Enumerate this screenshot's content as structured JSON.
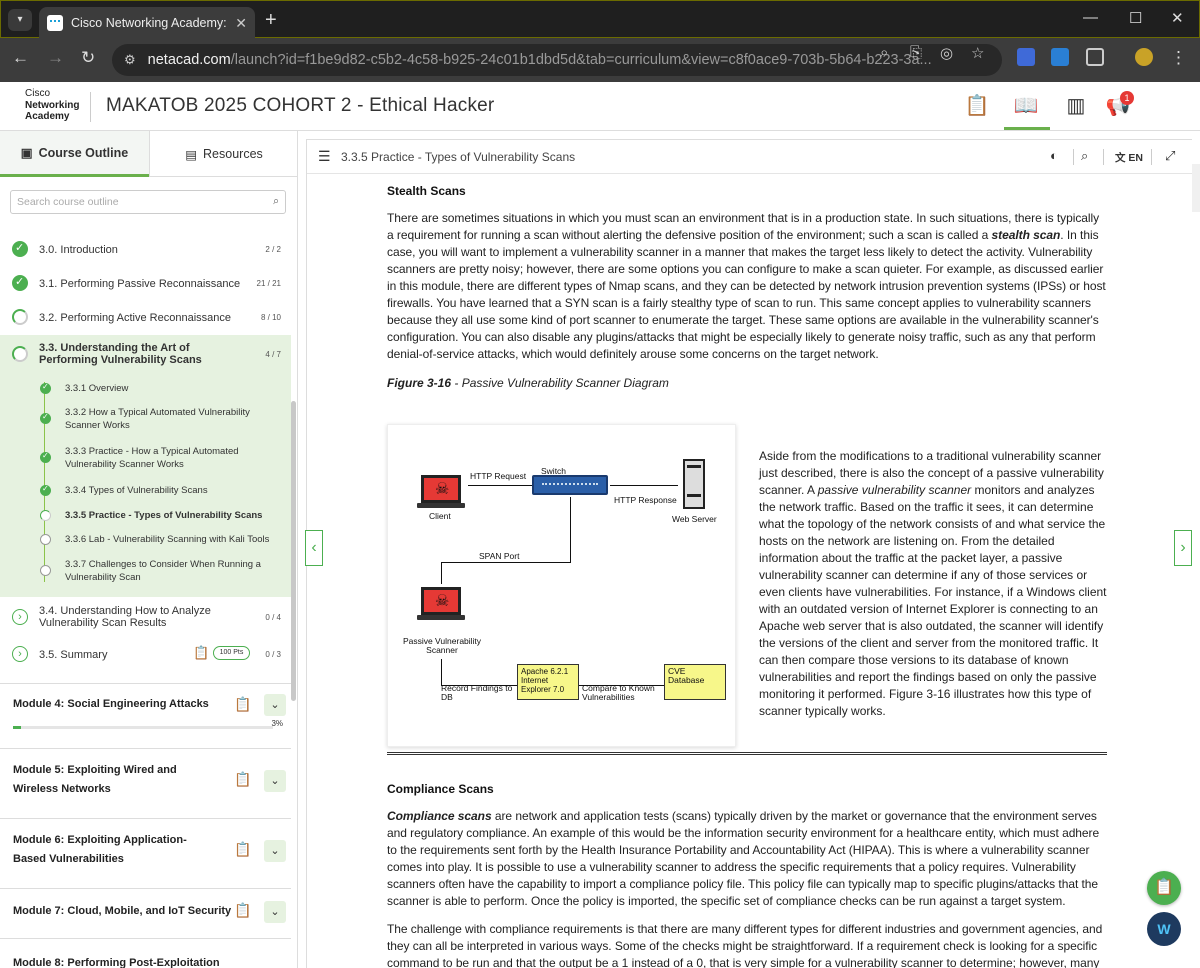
{
  "browser": {
    "tab_title": "Cisco Networking Academy: MA",
    "url_host": "netacad.com",
    "url_path": "/launch?id=f1be9d82-c5b2-4c58-b925-24c01b1dbd5d&tab=curriculum&view=c8f0ace9-703b-5b64-b223-3a..."
  },
  "app": {
    "logo_line1": "Cisco",
    "logo_line2": "Networking",
    "logo_line3": "Academy",
    "course_title": "MAKATOB 2025 COHORT 2 - Ethical Hacker",
    "notification_count": "1"
  },
  "sidebar": {
    "tab_outline": "Course Outline",
    "tab_resources": "Resources",
    "search_placeholder": "Search course outline",
    "topics": [
      {
        "label": "3.0. Introduction",
        "count": "2 / 2"
      },
      {
        "label": "3.1. Performing Passive Reconnaissance",
        "count": "21 / 21"
      },
      {
        "label": "3.2. Performing Active Reconnaissance",
        "count": "8 / 10"
      },
      {
        "label": "3.3. Understanding the Art of Performing Vulnerability Scans",
        "count": "4 / 7"
      },
      {
        "label": "3.4. Understanding How to Analyze Vulnerability Scan Results",
        "count": "0 / 4"
      },
      {
        "label": "3.5. Summary",
        "count": "0 / 3",
        "points": "100 Pts"
      }
    ],
    "subtopics": [
      "3.3.1 Overview",
      "3.3.2 How a Typical Automated Vulnerability Scanner Works",
      "3.3.3 Practice - How a Typical Automated Vulnerability Scanner Works",
      "3.3.4 Types of Vulnerability Scans",
      "3.3.5 Practice - Types of Vulnerability Scans",
      "3.3.6 Lab - Vulnerability Scanning with Kali Tools",
      "3.3.7 Challenges to Consider When Running a Vulnerability Scan"
    ],
    "modules": [
      {
        "title": "Module 4: Social Engineering Attacks",
        "progress": "3%"
      },
      {
        "title": "Module 5: Exploiting Wired and Wireless Networks"
      },
      {
        "title": "Module 6: Exploiting Application-Based Vulnerabilities"
      },
      {
        "title": "Module 7: Cloud, Mobile, and IoT Security"
      },
      {
        "title": "Module 8: Performing Post-Exploitation"
      }
    ]
  },
  "content": {
    "breadcrumb": "3.3.5 Practice - Types of Vulnerability Scans",
    "language": "EN",
    "stealth_heading": "Stealth Scans",
    "stealth_para_a": "There are sometimes situations in which you must scan an environment that is in a production state. In such situations, there is typically a requirement for running a scan without alerting the defensive position of the environment; such a scan is called a ",
    "stealth_term": "stealth scan",
    "stealth_para_b": ". In this case, you will want to implement a vulnerability scanner in a manner that makes the target less likely to detect the activity. Vulnerability scanners are pretty noisy; however, there are some options you can configure to make a scan quieter. For example, as discussed earlier in this module, there are different types of Nmap scans, and they can be detected by network intrusion prevention systems (IPSs) or host firewalls. You have learned that a SYN scan is a fairly stealthy type of scan to run. This same concept applies to vulnerability scanners because they all use some kind of port scanner to enumerate the target. These same options are available in the vulnerability scanner's configuration. You can also disable any plugins/attacks that might be especially likely to generate noisy traffic, such as any that perform denial-of-service attacks, which would definitely arouse some concerns on the target network.",
    "figure_label": "Figure 3-16",
    "figure_caption": " - Passive Vulnerability Scanner Diagram",
    "diagram": {
      "http_request": "HTTP Request",
      "switch": "Switch",
      "http_response": "HTTP Response",
      "client": "Client",
      "web_server": "Web Server",
      "span_port": "SPAN Port",
      "passive_scanner": "Passive Vulnerability Scanner",
      "record_findings": "Record Findings to DB",
      "apache": "Apache 6.2.1",
      "ie": "Internet Explorer 7.0",
      "compare": "Compare to Known Vulnerabilities",
      "cve": "CVE Database"
    },
    "passive_para_a": "Aside from the modifications to a traditional vulnerability scanner just described, there is also the concept of a passive vulnerability scanner. A ",
    "passive_term": "passive vulnerability scanner",
    "passive_para_b": " monitors and analyzes the network traffic. Based on the traffic it sees, it can determine what the topology of the network consists of and what service the hosts on the network are listening on. From the detailed information about the traffic at the packet layer, a passive vulnerability scanner can determine if any of those services or even clients have vulnerabilities. For instance, if a Windows client with an outdated version of Internet Explorer is connecting to an Apache web server that is also outdated, the scanner will identify the versions of the client and server from the monitored traffic. It can then compare those versions to its database of known vulnerabilities and report the findings based on only the passive monitoring it performed. Figure 3-16 illustrates how this type of scanner typically works.",
    "compliance_heading": "Compliance Scans",
    "compliance_term": "Compliance scans",
    "compliance_para": " are network and application tests (scans) typically driven by the market or governance that the environment serves and regulatory compliance. An example of this would be the information security environment for a healthcare entity, which must adhere to the requirements sent forth by the Health Insurance Portability and Accountability Act (HIPAA). This is where a vulnerability scanner comes into play. It is possible to use a vulnerability scanner to address the specific requirements that a policy requires. Vulnerability scanners often have the capability to import a compliance policy file. This policy file can typically map to specific plugins/attacks that the scanner is able to perform. Once the policy is imported, the specific set of compliance checks can be run against a target system.",
    "challenge_para": "The challenge with compliance requirements is that there are many different types for different industries and government agencies, and they can all be interpreted in various ways. Some of the checks might be straightforward. If a requirement check is looking for a specific command to be run and that the output be a 1 instead of a 0, that is very simple for a vulnerability scanner to determine; however, many"
  },
  "colors": {
    "accent_green": "#4caf50",
    "highlight": "#e6f2e0",
    "switch_blue": "#2b5fa8"
  }
}
